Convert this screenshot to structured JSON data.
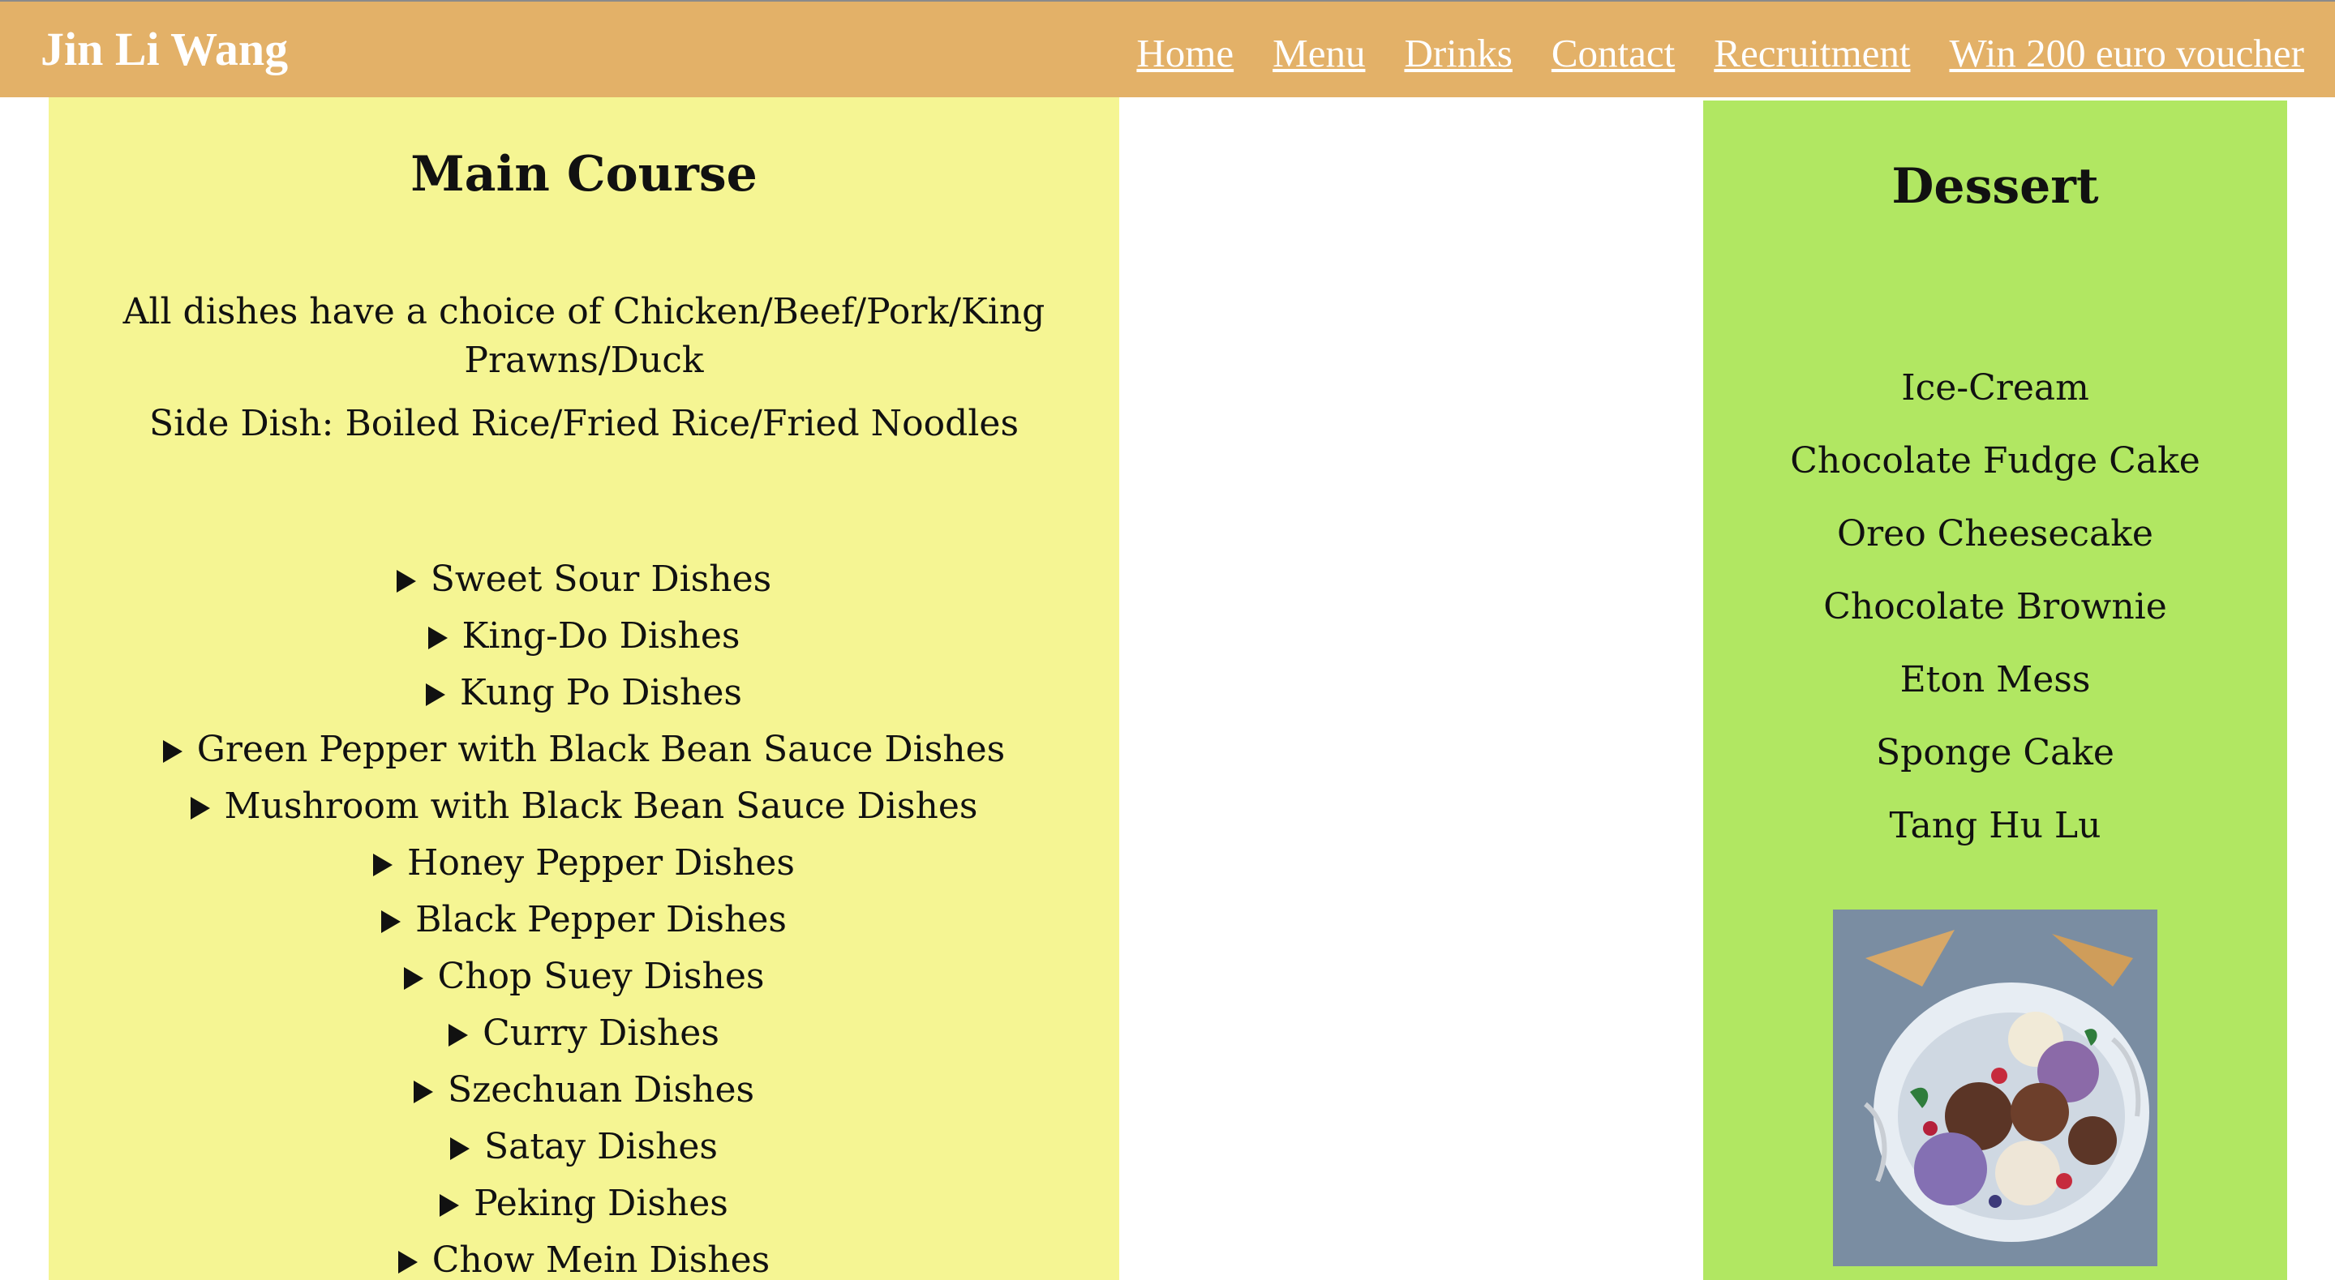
{
  "header": {
    "brand": "Jin Li Wang",
    "nav": [
      "Home",
      "Menu",
      "Drinks",
      "Contact",
      "Recruitment",
      "Win 200 euro voucher"
    ],
    "background_color": "#e3b168"
  },
  "main_course": {
    "title": "Main Course",
    "note_protein": "All dishes have a choice of Chicken/Beef/Pork/King Prawns/Duck",
    "note_side": "Side Dish: Boiled Rice/Fried Rice/Fried Noodles",
    "dishes": [
      "Sweet Sour Dishes",
      "King-Do Dishes",
      "Kung Po Dishes",
      "Green Pepper with Black Bean Sauce Dishes",
      "Mushroom with Black Bean Sauce Dishes",
      "Honey Pepper Dishes",
      "Black Pepper Dishes",
      "Chop Suey Dishes",
      "Curry Dishes",
      "Szechuan Dishes",
      "Satay Dishes",
      "Peking Dishes",
      "Chow Mein Dishes"
    ],
    "background_color": "#f5f593"
  },
  "dessert": {
    "title": "Dessert",
    "items": [
      "Ice-Cream",
      "Chocolate Fudge Cake",
      "Oreo Cheesecake",
      "Chocolate Brownie",
      "Eton Mess",
      "Sponge Cake",
      "Tang Hu Lu"
    ],
    "background_color": "#b1e762"
  }
}
